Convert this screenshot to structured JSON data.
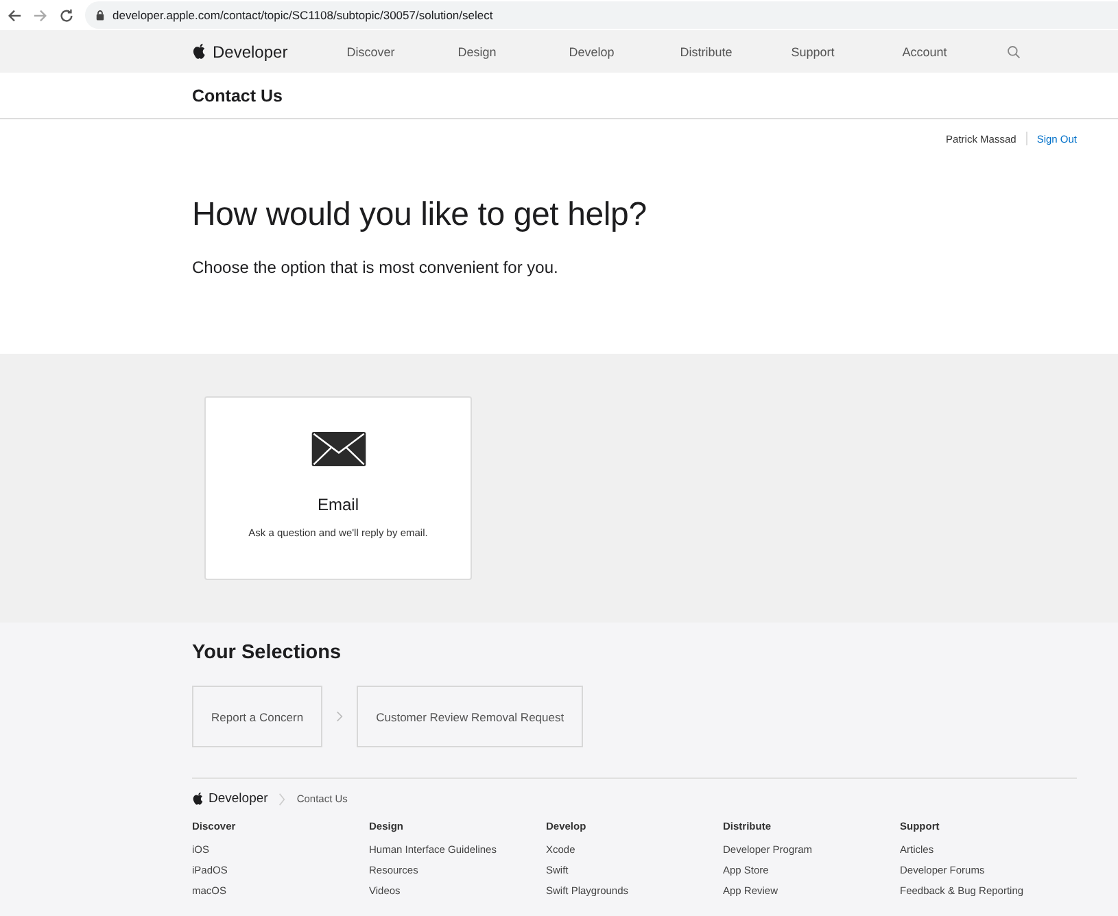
{
  "browser": {
    "url": "developer.apple.com/contact/topic/SC1108/subtopic/30057/solution/select"
  },
  "nav": {
    "brand": "Developer",
    "items": [
      "Discover",
      "Design",
      "Develop",
      "Distribute",
      "Support",
      "Account"
    ]
  },
  "subnav": {
    "title": "Contact Us"
  },
  "user": {
    "name": "Patrick Massad",
    "action": "Sign Out"
  },
  "hero": {
    "title": "How would you like to get help?",
    "subtitle": "Choose the option that is most convenient for you."
  },
  "options": [
    {
      "kind": "email",
      "title": "Email",
      "description": "Ask a question and we'll reply by email."
    }
  ],
  "selections": {
    "title": "Your Selections",
    "items": [
      "Report a Concern",
      "Customer Review Removal Request"
    ]
  },
  "footer": {
    "brand": "Developer",
    "crumb": "Contact Us",
    "columns": [
      {
        "heading": "Discover",
        "links": [
          "iOS",
          "iPadOS",
          "macOS"
        ]
      },
      {
        "heading": "Design",
        "links": [
          "Human Interface Guidelines",
          "Resources",
          "Videos"
        ]
      },
      {
        "heading": "Develop",
        "links": [
          "Xcode",
          "Swift",
          "Swift Playgrounds"
        ]
      },
      {
        "heading": "Distribute",
        "links": [
          "Developer Program",
          "App Store",
          "App Review"
        ]
      },
      {
        "heading": "Support",
        "links": [
          "Articles",
          "Developer Forums",
          "Feedback & Bug Reporting"
        ]
      }
    ]
  }
}
